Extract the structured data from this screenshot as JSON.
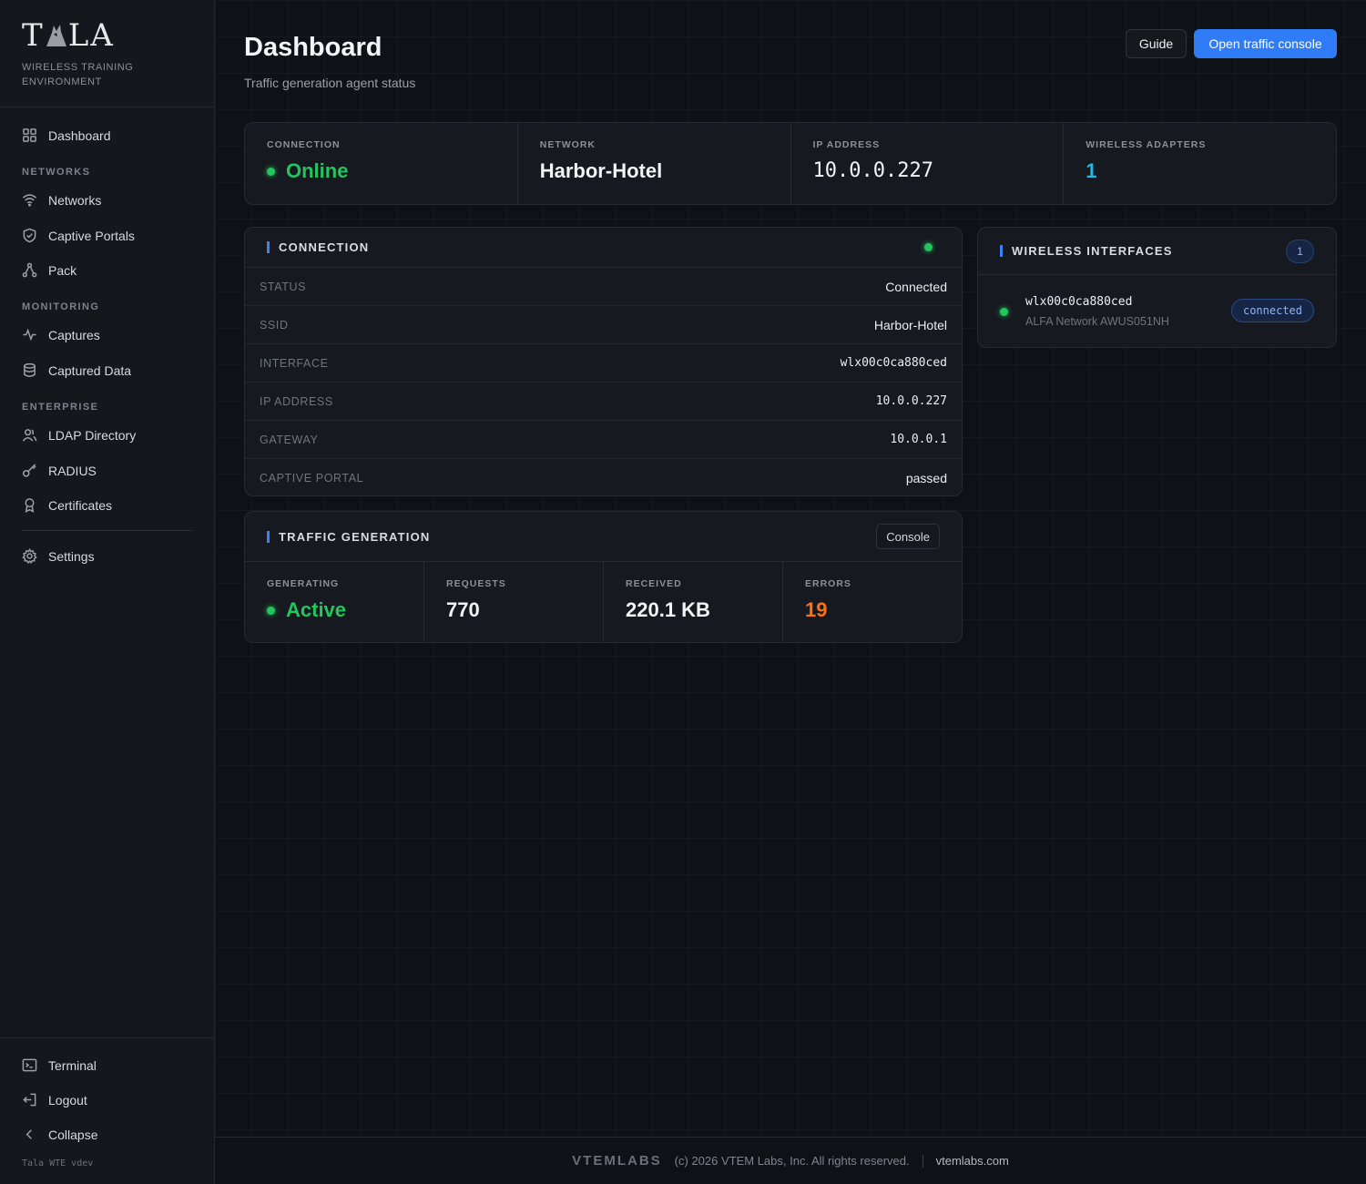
{
  "sidebar": {
    "logo": "TALA",
    "tagline": "WIRELESS TRAINING ENVIRONMENT",
    "items": {
      "dashboard": "Dashboard",
      "networks": "Networks",
      "captive_portals": "Captive Portals",
      "pack": "Pack",
      "captures": "Captures",
      "captured_data": "Captured Data",
      "ldap": "LDAP Directory",
      "radius": "RADIUS",
      "certificates": "Certificates",
      "settings": "Settings",
      "terminal": "Terminal",
      "logout": "Logout",
      "collapse": "Collapse"
    },
    "sections": {
      "networks": "NETWORKS",
      "monitoring": "MONITORING",
      "enterprise": "ENTERPRISE"
    },
    "version": "Tala WTE vdev"
  },
  "header": {
    "title": "Dashboard",
    "subtitle": "Traffic generation agent status",
    "guide_label": "Guide",
    "console_label": "Open traffic console"
  },
  "stats": {
    "connection_label": "CONNECTION",
    "connection_value": "Online",
    "network_label": "NETWORK",
    "network_value": "Harbor-Hotel",
    "ip_label": "IP ADDRESS",
    "ip_value": "10.0.0.227",
    "adapters_label": "WIRELESS ADAPTERS",
    "adapters_value": "1"
  },
  "connection_panel": {
    "title": "CONNECTION",
    "rows": [
      {
        "key": "STATUS",
        "value": "Connected"
      },
      {
        "key": "SSID",
        "value": "Harbor-Hotel"
      },
      {
        "key": "INTERFACE",
        "value": "wlx00c0ca880ced"
      },
      {
        "key": "IP ADDRESS",
        "value": "10.0.0.227"
      },
      {
        "key": "GATEWAY",
        "value": "10.0.0.1"
      },
      {
        "key": "CAPTIVE PORTAL",
        "value": "passed"
      }
    ]
  },
  "traffic_panel": {
    "title": "TRAFFIC GENERATION",
    "console_label": "Console",
    "generating_label": "GENERATING",
    "generating_value": "Active",
    "requests_label": "REQUESTS",
    "requests_value": "770",
    "received_label": "RECEIVED",
    "received_value": "220.1 KB",
    "errors_label": "ERRORS",
    "errors_value": "19"
  },
  "wireless_panel": {
    "title": "WIRELESS INTERFACES",
    "count": "1",
    "interfaces": [
      {
        "name": "wlx00c0ca880ced",
        "model": "ALFA Network AWUS051NH",
        "status": "connected"
      }
    ]
  },
  "footer": {
    "brand": "VTEMLABS",
    "copyright": "(c) 2026 VTEM Labs, Inc. All rights reserved.",
    "link": "vtemlabs.com"
  },
  "colors": {
    "accent": "#2f7cf6",
    "online": "#22c55e",
    "adapters": "#22b8e6",
    "errors": "#f97316"
  }
}
